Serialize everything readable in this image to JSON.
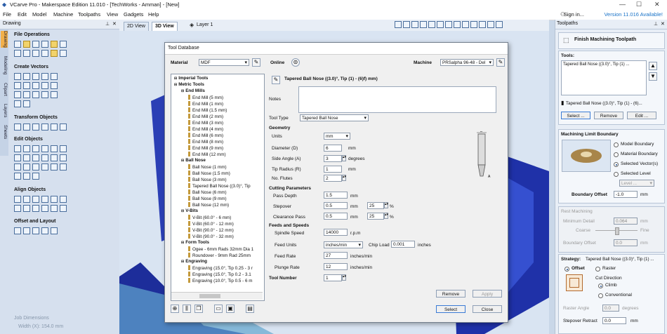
{
  "titlebar": {
    "title": "VCarve Pro - Makerspace Edition 11.010 - [TechWorks - Amman] - [New]",
    "min": "—",
    "max": "☐",
    "close": "✕"
  },
  "menu": [
    "File",
    "Edit",
    "Model",
    "Machine",
    "Toolpaths",
    "View",
    "Gadgets",
    "Help"
  ],
  "signin": "Sign in...",
  "version": "Version 11.016 Available!",
  "left": {
    "header": "Drawing",
    "side_tabs": [
      "Drawing",
      "Modeling",
      "Clipart",
      "Layers",
      "Sheets"
    ],
    "sections": [
      "File Operations",
      "Create Vectors",
      "Transform Objects",
      "Edit Objects",
      "Align Objects",
      "Offset and Layout"
    ],
    "job_dimensions": "Job Dimensions",
    "job_width": "Width  (X): 154.0 mm"
  },
  "view": {
    "tab_2d": "2D View",
    "tab_3d": "3D View",
    "layer": "Layer 1"
  },
  "right": {
    "header": "Toolpaths",
    "title": "Finish Machining Toolpath",
    "tools_label": "Tools:",
    "tool_item": "Tapered Ball Nose ((3.0)°, Tip (1) ...",
    "tool_selected": "Tapered Ball Nose ((3.0)°, Tip (1) - (6)...",
    "select_btn": "Select ...",
    "remove_btn": "Remove",
    "edit_btn": "Edit ...",
    "boundary_title": "Machining Limit Boundary",
    "model_boundary": "Model Boundary",
    "material_boundary": "Material Boundary",
    "selected_vectors": "Selected Vector(s)",
    "selected_level": "Selected Level",
    "level_value": "Level ...",
    "boundary_offset_label": "Boundary Offset",
    "boundary_offset": "-1.0",
    "mm": "mm",
    "rest_title": "Rest Machining",
    "min_detail": "Minimum Detail",
    "min_detail_val": "0.064",
    "coarse": "Coarse",
    "fine": "Fine",
    "boundary_offset2": "Boundary Offset",
    "bo2_val": "0.0",
    "strategy_label": "Strategy:",
    "strategy_tool": "Tapered Ball Nose ((3.0)°, Tip (1) ...",
    "offset": "Offset",
    "raster": "Raster",
    "cut_direction": "Cut Direction",
    "climb": "Climb",
    "conventional": "Conventional",
    "raster_angle": "Raster Angle",
    "raster_angle_val": "0.0",
    "degrees": "degrees",
    "stepover_retract": "Stepover Retract",
    "stepover_retract_val": "0.0"
  },
  "dialog": {
    "title": "Tool Database",
    "material_label": "Material",
    "material": "MDF",
    "online": "Online",
    "machine_label": "Machine",
    "machine": "PRSalpha 96-48 - Del",
    "tool_name": "Tapered Ball Nose ((3.0)°, Tip (1) - (6)f) mm)",
    "notes_label": "Notes",
    "tooltype_label": "Tool Type",
    "tooltype": "Tapered Ball Nose",
    "geometry": "Geometry",
    "units_label": "Units",
    "units": "mm",
    "diameter_label": "Diameter (D)",
    "diameter": "6",
    "side_angle_label": "Side Angle (A)",
    "side_angle": "3",
    "degrees": "degrees",
    "tip_radius_label": "Tip Radius (R)",
    "tip_radius": "1",
    "flutes_label": "No. Flutes",
    "flutes": "2",
    "mm": "mm",
    "cutting": "Cutting Parameters",
    "pass_depth_label": "Pass Depth",
    "pass_depth": "1.5",
    "stepover_label": "Stepover",
    "stepover": "0.5",
    "stepover_pct": "25",
    "clearance_label": "Clearance Pass",
    "clearance": "0.5",
    "clearance_pct": "25",
    "pct": "%",
    "feeds": "Feeds and Speeds",
    "spindle_label": "Spindle Speed",
    "spindle": "14000",
    "rpm": "r.p.m",
    "feed_units_label": "Feed Units",
    "feed_units": "inches/min",
    "chip_load_label": "Chip Load",
    "chip_load": "0.001",
    "inches": "inches",
    "feed_rate_label": "Feed Rate",
    "feed_rate": "27",
    "plunge_label": "Plunge Rate",
    "plunge": "12",
    "inmin": "inches/min",
    "tool_number_label": "Tool Number",
    "tool_number": "1",
    "diagram_D": "D",
    "diagram_A": "A",
    "remove_btn": "Remove",
    "apply_btn": "Apply",
    "select_btn": "Select",
    "close_btn": "Close",
    "tree": [
      {
        "t": "Imperial Tools",
        "lvl": 0,
        "b": true,
        "bit": false
      },
      {
        "t": "Metric Tools",
        "lvl": 0,
        "b": true,
        "bit": false
      },
      {
        "t": "End Mills",
        "lvl": 1,
        "b": true,
        "bit": false
      },
      {
        "t": "End Mill (5 mm)",
        "lvl": 2,
        "b": false,
        "bit": true
      },
      {
        "t": "End Mill (1 mm)",
        "lvl": 2,
        "b": false,
        "bit": true
      },
      {
        "t": "End Mill (1.5 mm)",
        "lvl": 2,
        "b": false,
        "bit": true
      },
      {
        "t": "End Mill (2 mm)",
        "lvl": 2,
        "b": false,
        "bit": true
      },
      {
        "t": "End Mill (3 mm)",
        "lvl": 2,
        "b": false,
        "bit": true
      },
      {
        "t": "End Mill (4 mm)",
        "lvl": 2,
        "b": false,
        "bit": true
      },
      {
        "t": "End Mill (6 mm)",
        "lvl": 2,
        "b": false,
        "bit": true
      },
      {
        "t": "End Mill (8 mm)",
        "lvl": 2,
        "b": false,
        "bit": true
      },
      {
        "t": "End Mill (9 mm)",
        "lvl": 2,
        "b": false,
        "bit": true
      },
      {
        "t": "End Mill (12 mm)",
        "lvl": 2,
        "b": false,
        "bit": true
      },
      {
        "t": "Ball Nose",
        "lvl": 1,
        "b": true,
        "bit": false
      },
      {
        "t": "Ball Nose (1 mm)",
        "lvl": 2,
        "b": false,
        "bit": true
      },
      {
        "t": "Ball Nose (1.5 mm)",
        "lvl": 2,
        "b": false,
        "bit": true
      },
      {
        "t": "Ball Nose (3 mm)",
        "lvl": 2,
        "b": false,
        "bit": true
      },
      {
        "t": "Tapered Ball Nose ((3.0)°, Tip",
        "lvl": 2,
        "b": false,
        "bit": true
      },
      {
        "t": "Ball Nose (6 mm)",
        "lvl": 2,
        "b": false,
        "bit": true
      },
      {
        "t": "Ball Nose (9 mm)",
        "lvl": 2,
        "b": false,
        "bit": true
      },
      {
        "t": "Ball Nose (12 mm)",
        "lvl": 2,
        "b": false,
        "bit": true
      },
      {
        "t": "V-Bits",
        "lvl": 1,
        "b": true,
        "bit": false
      },
      {
        "t": "V-Bit (60.0° - 6 mm)",
        "lvl": 2,
        "b": false,
        "bit": true
      },
      {
        "t": "V-Bit (60.0° - 12 mm)",
        "lvl": 2,
        "b": false,
        "bit": true
      },
      {
        "t": "V-Bit (90.0° - 12 mm)",
        "lvl": 2,
        "b": false,
        "bit": true
      },
      {
        "t": "V-Bit (90.0° - 32 mm)",
        "lvl": 2,
        "b": false,
        "bit": true
      },
      {
        "t": "Form Tools",
        "lvl": 1,
        "b": true,
        "bit": false
      },
      {
        "t": "Ogee - 6mm Rads 32mm Dia 1",
        "lvl": 2,
        "b": false,
        "bit": true
      },
      {
        "t": "Roundover - 9mm Rad 25mm",
        "lvl": 2,
        "b": false,
        "bit": true
      },
      {
        "t": "Engraving",
        "lvl": 1,
        "b": true,
        "bit": false
      },
      {
        "t": "Engraving (15.0°, Tip 0.25 - 3 r",
        "lvl": 2,
        "b": false,
        "bit": true
      },
      {
        "t": "Engraving (15.0°, Tip 0.2 - 3.1",
        "lvl": 2,
        "b": false,
        "bit": true
      },
      {
        "t": "Engraving (10.0°, Tip 0.5 - 6 m",
        "lvl": 2,
        "b": false,
        "bit": true
      }
    ]
  }
}
